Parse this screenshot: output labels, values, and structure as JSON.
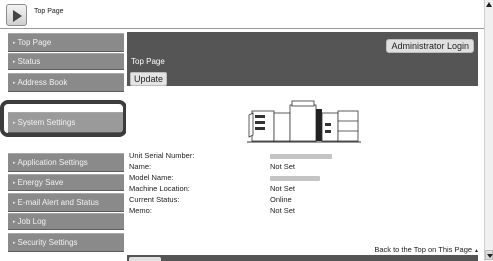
{
  "topbar": {
    "title": "Top Page"
  },
  "sidebar": {
    "items": [
      {
        "label": "Top Page"
      },
      {
        "label": "Status"
      },
      {
        "label": "Address Book"
      },
      {
        "label": "System Settings"
      },
      {
        "label": "Application Settings"
      },
      {
        "label": "Energy Save"
      },
      {
        "label": "E-mail Alert and Status"
      },
      {
        "label": "Job Log"
      },
      {
        "label": "Security Settings"
      }
    ]
  },
  "main": {
    "admin_login": "Administrator Login",
    "page_title": "Top Page",
    "update_label": "Update",
    "info": {
      "serial_label": "Unit Serial Number:",
      "name_label": "Name:",
      "name_value": "Not Set",
      "model_label": "Model Name:",
      "location_label": "Machine Location:",
      "location_value": "Not Set",
      "status_label": "Current Status:",
      "status_value": "Online",
      "memo_label": "Memo:",
      "memo_value": "Not Set"
    },
    "back_to_top": "Back to the Top on This Page"
  },
  "colors": {
    "title_band": "#555555",
    "sidebar_item": "#8a8a8a",
    "highlight_ring": "#3c3c3c"
  }
}
